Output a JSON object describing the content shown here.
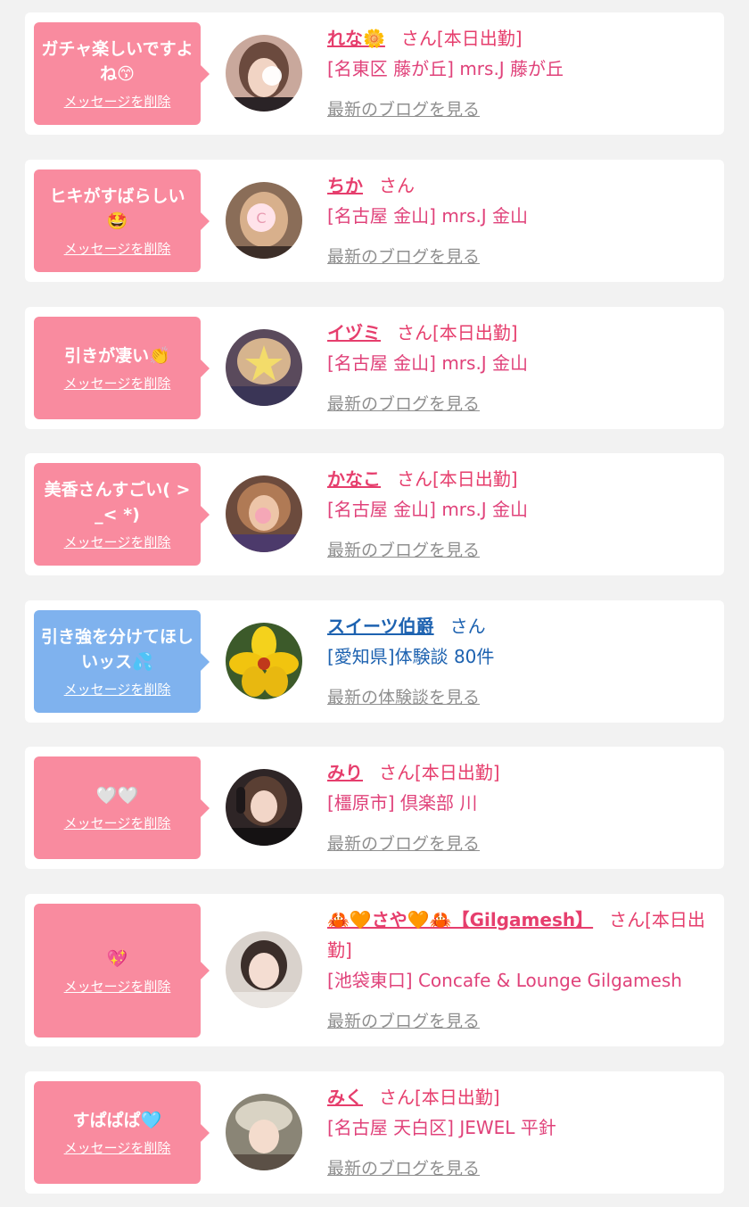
{
  "colors": {
    "pink_bubble": "#f98b9f",
    "blue_bubble": "#7fb2ee",
    "pink_text": "#e63e6d",
    "blue_text": "#1d62b0",
    "muted": "#8f8f8f"
  },
  "delete_label": "メッセージを削除",
  "cards": [
    {
      "bubble_text": "ガチャ楽しいですよね😙",
      "delete_label": "メッセージを削除",
      "name": "れな🌼",
      "suffix": "さん[本日出勤]",
      "shop": "[名東区 藤が丘] mrs.J 藤が丘",
      "latest": "最新のブログを見る"
    },
    {
      "bubble_text": "ヒキがすばらしい🤩",
      "delete_label": "メッセージを削除",
      "name": "ちか",
      "suffix": "さん",
      "shop": "[名古屋 金山] mrs.J 金山",
      "latest": "最新のブログを見る"
    },
    {
      "bubble_text": "引きが凄い👏",
      "delete_label": "メッセージを削除",
      "name": "イヅミ",
      "suffix": "さん[本日出勤]",
      "shop": "[名古屋 金山] mrs.J 金山",
      "latest": "最新のブログを見る"
    },
    {
      "bubble_text": "美香さんすごい( > _< *)",
      "delete_label": "メッセージを削除",
      "name": "かなこ",
      "suffix": "さん[本日出勤]",
      "shop": "[名古屋 金山] mrs.J 金山",
      "latest": "最新のブログを見る"
    },
    {
      "bubble_text": "引き強を分けてほしいッス💦",
      "delete_label": "メッセージを削除",
      "name": "スイーツ伯爵",
      "suffix": "さん",
      "shop": "[愛知県]体験談 80件",
      "latest": "最新の体験談を見る"
    },
    {
      "bubble_text": "🤍🤍",
      "delete_label": "メッセージを削除",
      "name": "みり",
      "suffix": "さん[本日出勤]",
      "shop": "[橿原市] 倶楽部 川",
      "latest": "最新のブログを見る"
    },
    {
      "bubble_text": "💖",
      "delete_label": "メッセージを削除",
      "name": "🦀🧡さや🧡🦀【Gilgamesh】",
      "suffix": "さん[本日出勤]",
      "shop": "[池袋東口] Concafe & Lounge Gilgamesh",
      "latest": "最新のブログを見る"
    },
    {
      "bubble_text": "すぱぱぱ🩵",
      "delete_label": "メッセージを削除",
      "name": "みく",
      "suffix": "さん[本日出勤]",
      "shop": "[名古屋 天白区] JEWEL 平針",
      "latest": "最新のブログを見る"
    }
  ]
}
